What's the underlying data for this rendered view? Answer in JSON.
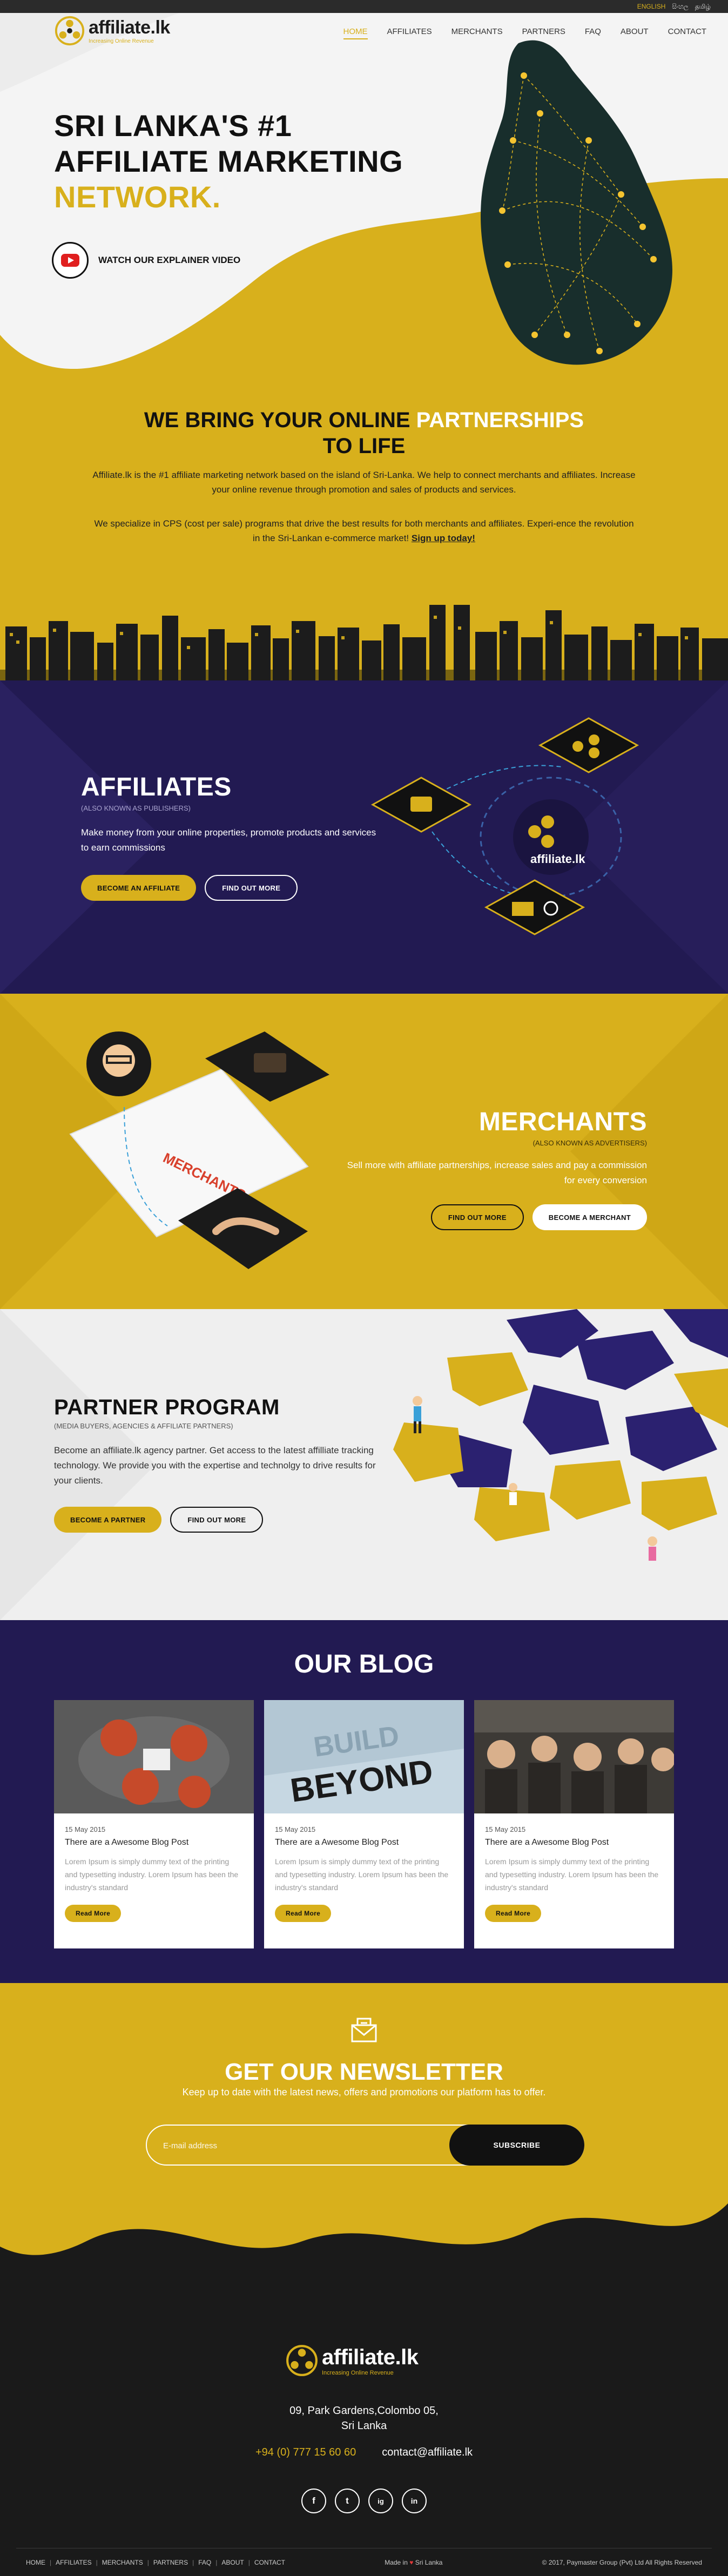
{
  "topbar": {
    "languages": [
      "ENGLISH",
      "සිංහල",
      "தமிழ்"
    ]
  },
  "brand": {
    "name": "affiliate.lk",
    "tagline": "Increasing Online Revenue"
  },
  "nav": [
    "HOME",
    "AFFILIATES",
    "MERCHANTS",
    "PARTNERS",
    "FAQ",
    "ABOUT",
    "CONTACT"
  ],
  "hero": {
    "line1": "SRI LANKA'S #1",
    "line2": "AFFILIATE MARKETING",
    "line3": "NETWORK.",
    "video_label": "WATCH OUR EXPLAINER VIDEO"
  },
  "intro": {
    "title_a": "WE BRING YOUR ONLINE ",
    "title_b": "PARTNERSHIPS",
    "title_c": "TO LIFE",
    "p1": "Affiliate.lk is the #1 affiliate marketing network based on the island of Sri-Lanka. We help to connect merchants and affiliates. Increase your online revenue through promotion and sales of products and services.",
    "p2": "We specialize in CPS (cost per sale) programs that drive the best results for both merchants and affiliates. Experi-ence the revolution in the Sri-Lankan e-commerce market! ",
    "p2_link": "Sign up today!"
  },
  "affiliates": {
    "title": "AFFILIATES",
    "sub": "(ALSO KNOWN AS PUBLISHERS)",
    "desc": "Make money from your online properties, promote products and services to earn commissions",
    "btn_primary": "BECOME AN AFFILIATE",
    "btn_secondary": "FIND OUT MORE",
    "hub_label": "affiliate.lk"
  },
  "merchants": {
    "title": "MERCHANTS",
    "sub": "(ALSO KNOWN AS ADVERTISERS)",
    "desc": "Sell more with affiliate partnerships, increase sales and pay a commission for every conversion",
    "btn_secondary": "FIND OUT MORE",
    "btn_primary": "BECOME A MERCHANT",
    "doc_label": "MERCHANTS"
  },
  "partner": {
    "title": "PARTNER PROGRAM",
    "sub": "(MEDIA BUYERS, AGENCIES & AFFILIATE PARTNERS)",
    "desc": "Become an affiliate.lk agency partner. Get access to the latest affilliate tracking technology. We provide you with the expertise and technolgy to drive results for your clients.",
    "btn_primary": "BECOME A PARTNER",
    "btn_secondary": "FIND OUT MORE"
  },
  "blog": {
    "title": "OUR BLOG",
    "image_text_1": "BUILD",
    "image_text_2": "BEYOND",
    "posts": [
      {
        "date": "15 May 2015",
        "title": "There are a Awesome Blog Post",
        "text": "Lorem Ipsum is simply dummy text of the printing and typesetting industry. Lorem Ipsum has been the industry's standard",
        "cta": "Read More"
      },
      {
        "date": "15 May 2015",
        "title": "There are a Awesome Blog Post",
        "text": "Lorem Ipsum is simply dummy text of the printing and typesetting industry. Lorem Ipsum has been the industry's standard",
        "cta": "Read More"
      },
      {
        "date": "15 May 2015",
        "title": "There are a Awesome Blog Post",
        "text": "Lorem Ipsum is simply dummy text of the printing and typesetting industry. Lorem Ipsum has been the industry's standard",
        "cta": "Read More"
      }
    ]
  },
  "newsletter": {
    "title": "GET OUR NEWSLETTER",
    "desc": "Keep up to date with the latest news, offers and promotions our platform has to offer.",
    "placeholder": "E-mail address",
    "button": "SUBSCRIBE"
  },
  "footer": {
    "address_1": "09, Park Gardens,Colombo 05,",
    "address_2": "Sri Lanka",
    "phone": "+94 (0) 777 15 60 60",
    "email": "contact@affiliate.lk",
    "socials": [
      "f",
      "t",
      "ig",
      "in"
    ],
    "links": [
      "HOME",
      "AFFILIATES",
      "MERCHANTS",
      "PARTNERS",
      "FAQ",
      "ABOUT",
      "CONTACT"
    ],
    "made_in_a": "Made in",
    "made_in_b": "Sri Lanka",
    "copyright": "© 2017, Paymaster Group (Pvt) Ltd All Rights Reserved"
  },
  "colors": {
    "accent": "#d8b01c",
    "navy": "#221a52",
    "dark": "#1a1a1a"
  }
}
